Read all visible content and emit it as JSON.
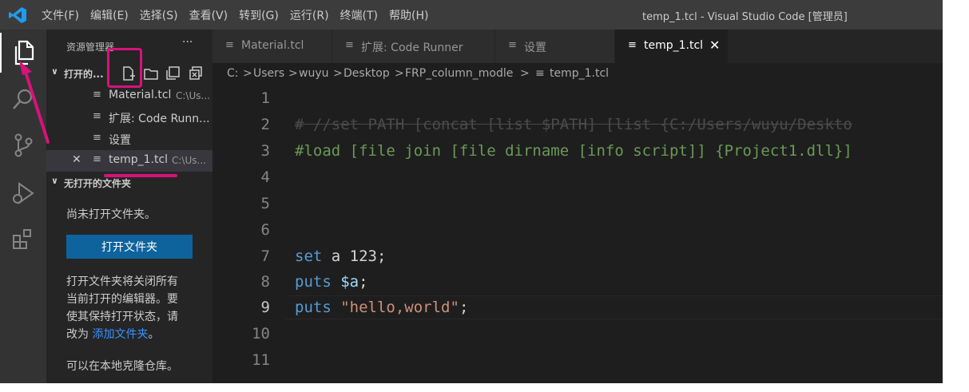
{
  "menu": [
    "文件(F)",
    "编辑(E)",
    "选择(S)",
    "查看(V)",
    "转到(G)",
    "运行(R)",
    "终端(T)",
    "帮助(H)"
  ],
  "window_title": "temp_1.tcl - Visual Studio Code [管理员]",
  "sidebar": {
    "title": "资源管理器",
    "more": "···",
    "open_editors_label": "打开的...",
    "files": [
      {
        "name": "Material.tcl",
        "path": "C:\\Us..."
      },
      {
        "name": "扩展: Code Runn...",
        "path": ""
      },
      {
        "name": "设置",
        "path": ""
      },
      {
        "name": "temp_1.tcl",
        "path": "C:\\Us..."
      }
    ],
    "no_folder_label": "无打开的文件夹",
    "no_folder_msg": "尚未打开文件夹。",
    "open_folder_button": "打开文件夹",
    "info_1": "打开文件夹将关闭所有",
    "info_2": "当前打开的编辑器。要",
    "info_3": "使其保持打开状态，请",
    "info_4_prefix": "改为",
    "info_4_link": "添加文件夹",
    "info_4_suffix": "。",
    "clone_msg": "可以在本地克隆仓库。"
  },
  "tabs": [
    {
      "label": "Material.tcl"
    },
    {
      "label": "扩展: Code Runner"
    },
    {
      "label": "设置"
    },
    {
      "label": "temp_1.tcl",
      "close": "✕"
    }
  ],
  "breadcrumb": [
    "C:",
    "Users",
    "wuyu",
    "Desktop",
    "FRP_column_modle",
    "temp_1.tcl"
  ],
  "breadcrumb_sep": ">",
  "editor": {
    "line_numbers": [
      "1",
      "2",
      "3",
      "4",
      "5",
      "6",
      "7",
      "8",
      "9",
      "10",
      "11"
    ],
    "line2": "# //set PATH [concat [list $PATH] [list {C:/Users/wuyu/Deskto",
    "line3": "#load [file join [file dirname [info script]] {Project1.dll}]",
    "l7_kw": "set",
    "l7_rest": " a 123;",
    "l8_kw": "puts",
    "l8_var": "$a",
    "l8_end": ";",
    "l9_kw": "puts",
    "l9_str": "\"hello,world\"",
    "l9_end": ";"
  },
  "colors": {
    "accent": "#0e639c",
    "annotation": "#d8127a",
    "keyword": "#569cd6",
    "string": "#ce9178",
    "comment": "#6a9955"
  }
}
